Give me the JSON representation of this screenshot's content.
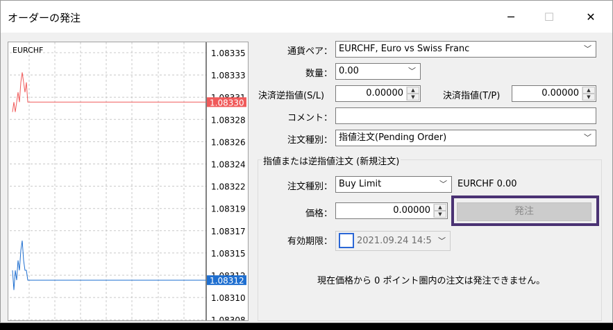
{
  "window": {
    "title": "オーダーの発注",
    "minimize": "─",
    "maximize": "☐",
    "close": "✕"
  },
  "chart": {
    "symbol": "EURCHF",
    "ticks": [
      "1.08335",
      "1.08333",
      "1.08331",
      "1.08328",
      "1.08326",
      "1.08324",
      "1.08322",
      "1.08319",
      "1.08317",
      "1.08315",
      "1.08312",
      "1.08310",
      "1.08308"
    ],
    "ask_label": "1.08330",
    "bid_label": "1.08312",
    "ask_color": "#f05a5a",
    "bid_color": "#1f6fd0",
    "bid_tick_overlapped": "1.08312",
    "ask_tick_overlapped": "1.08331"
  },
  "chart_data": {
    "type": "line",
    "title": "EURCHF",
    "ylim": [
      1.08307,
      1.08336
    ],
    "series": [
      {
        "values": [
          1.08329,
          1.0833,
          1.08329,
          1.0833,
          1.08331,
          1.0833,
          1.08332,
          1.08333,
          1.08332,
          1.08331,
          1.08332,
          1.0833,
          1.0833,
          1.0833,
          1.0833
        ]
      },
      {
        "values": [
          1.08313,
          1.08311,
          1.08313,
          1.08312,
          1.08314,
          1.08313,
          1.08315,
          1.08316,
          1.08314,
          1.08313,
          1.08313,
          1.08312,
          1.08312,
          1.08312,
          1.08312
        ]
      }
    ]
  },
  "form": {
    "pair_label": "通貨ペア：",
    "pair_value": "EURCHF, Euro vs Swiss Franc",
    "qty_label": "数量：",
    "qty_value": "0.00",
    "sl_label": "決済逆指値(S/L)",
    "sl_value": "0.00000",
    "tp_label": "決済指値(T/P)",
    "tp_value": "0.00000",
    "comment_label": "コメント：",
    "comment_value": "",
    "type_label": "注文種別：",
    "type_value": "指値注文(Pending Order)"
  },
  "pending": {
    "group_title": "指値または逆指値注文 (新規注文)",
    "type_label": "注文種別：",
    "type_value": "Buy Limit",
    "info": "EURCHF 0.00",
    "price_label": "価格：",
    "price_value": "0.00000",
    "submit_label": "発注",
    "expiry_label": "有効期限：",
    "expiry_value": "2021.09.24 14:5",
    "notice": "現在価格から 0 ポイント圏内の注文は発注できません。"
  }
}
